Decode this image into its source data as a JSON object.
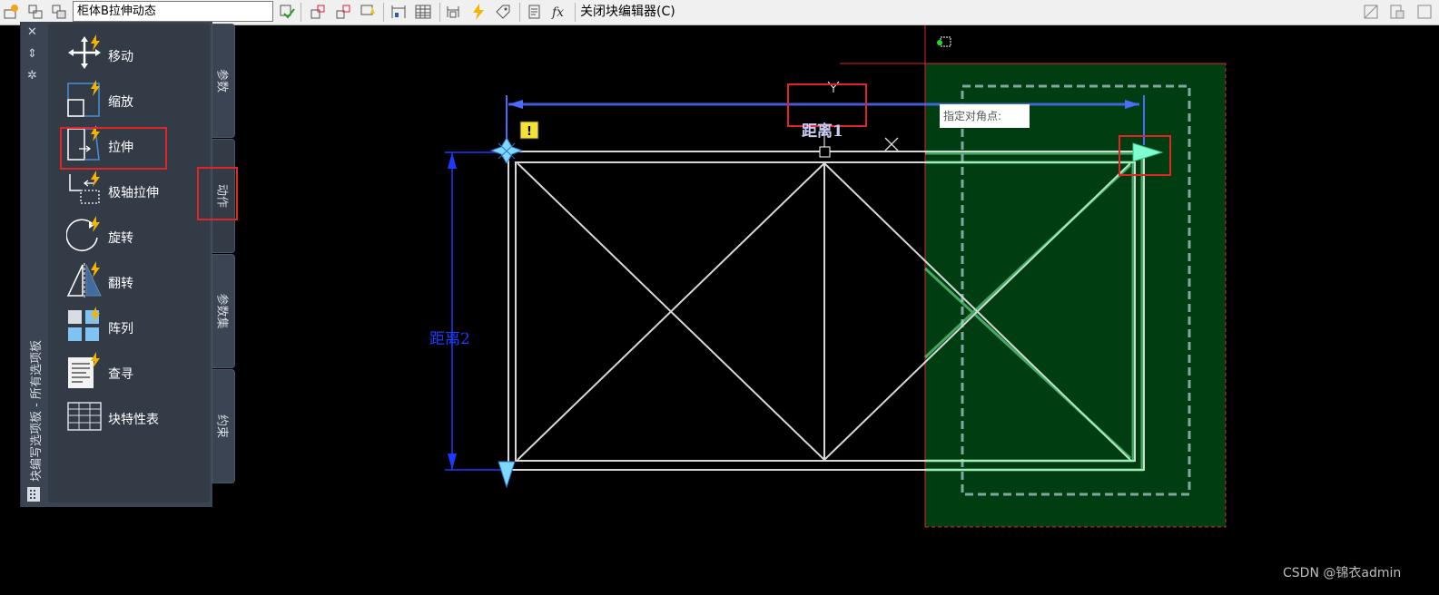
{
  "toolbar": {
    "block_name": "柜体B拉伸动态",
    "close_label": "关闭块编辑器(C)"
  },
  "palette": {
    "title": "块编写选项板 - 所有选项板",
    "controls": [
      "✕",
      "⇕",
      "✲"
    ],
    "tools": [
      {
        "label": "移动",
        "icon": "move-icon"
      },
      {
        "label": "缩放",
        "icon": "scale-icon"
      },
      {
        "label": "拉伸",
        "icon": "stretch-icon"
      },
      {
        "label": "极轴拉伸",
        "icon": "polar-stretch-icon"
      },
      {
        "label": "旋转",
        "icon": "rotate-icon"
      },
      {
        "label": "翻转",
        "icon": "flip-icon"
      },
      {
        "label": "阵列",
        "icon": "array-icon"
      },
      {
        "label": "查寻",
        "icon": "lookup-icon"
      },
      {
        "label": "块特性表",
        "icon": "block-table-icon"
      }
    ],
    "tabs": [
      "参数",
      "动作",
      "参数集",
      "约束"
    ],
    "active_tab": "动作"
  },
  "canvas": {
    "prompt": "指定对角点:",
    "param_labels": [
      "距离1",
      "距离2"
    ],
    "colors": {
      "selection_fill": "#003d10",
      "selection_border": "#e0252a",
      "grip": "#7fd8ff",
      "dimension": "#1b3bff"
    }
  },
  "watermark": "CSDN @锦衣admin"
}
